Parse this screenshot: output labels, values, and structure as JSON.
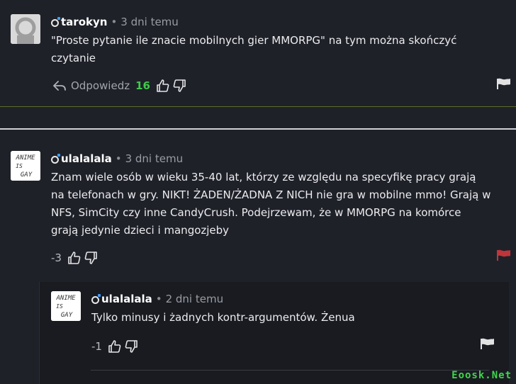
{
  "comments": [
    {
      "username": "tarokyn",
      "time": "3 dni temu",
      "text_lines": [
        "\"Proste pytanie  ile znacie mobilnych gier MMORPG\" na tym można skończyć",
        "czytanie"
      ],
      "reply_label": "Odpowiedz",
      "score": "16",
      "avatar": "default-avatar"
    },
    {
      "username": "ulalalala",
      "time": "3 dni temu",
      "text_lines": [
        "Znam wiele osób w wieku 35-40 lat, którzy ze względu na specyfikę pracy grają",
        "na telefonach w gry. NIKT! ŻADEN/ŻADNA Z NICH nie gra w mobilne mmo! Grają w",
        "NFS, SimCity czy inne CandyCrush. Podejrzewam, że w MMORPG na komórce",
        "grają jedynie dzieci i mangozjeby"
      ],
      "score": "-3",
      "avatar": "anime-is-gay-drawing",
      "avatar_text": [
        "ANIME",
        "IS",
        "GAY"
      ]
    },
    {
      "username": "ulalalala",
      "time": "2 dni temu",
      "text_lines": [
        "Tylko minusy i żadnych kontr-argumentów. Żenua"
      ],
      "score": "-1",
      "avatar": "anime-is-gay-drawing",
      "avatar_text": [
        "ANIME",
        "IS",
        "GAY"
      ]
    }
  ],
  "sep": "•",
  "watermark": "Eoosk.Net",
  "colors": {
    "background": "#1f2129",
    "score_positive": "#3ec94a",
    "flag_reported": "#c0353a",
    "flag_default": "#e2e2e2"
  }
}
